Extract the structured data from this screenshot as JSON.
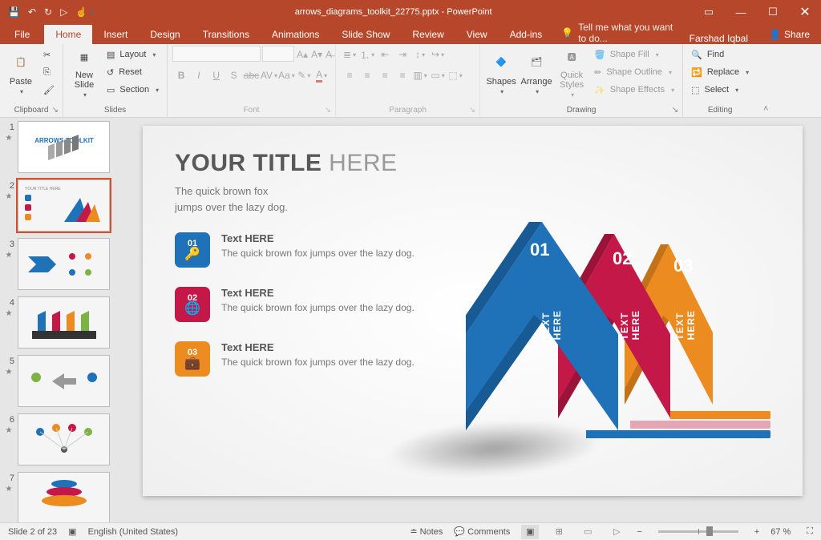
{
  "app": {
    "title": "arrows_diagrams_toolkit_22775.pptx - PowerPoint"
  },
  "qat": [
    "save",
    "undo",
    "redo",
    "start",
    "touch"
  ],
  "tabs": {
    "file": "File",
    "home": "Home",
    "insert": "Insert",
    "design": "Design",
    "transitions": "Transitions",
    "animations": "Animations",
    "slideshow": "Slide Show",
    "review": "Review",
    "view": "View",
    "addins": "Add-ins"
  },
  "tellme": "Tell me what you want to do...",
  "user": "Farshad Iqbal",
  "share": "Share",
  "ribbon": {
    "clipboard": {
      "label": "Clipboard",
      "paste": "Paste"
    },
    "slides": {
      "label": "Slides",
      "new": "New\nSlide",
      "layout": "Layout",
      "reset": "Reset",
      "section": "Section"
    },
    "font": {
      "label": "Font"
    },
    "paragraph": {
      "label": "Paragraph"
    },
    "drawing": {
      "label": "Drawing",
      "shapes": "Shapes",
      "arrange": "Arrange",
      "quick": "Quick\nStyles",
      "fill": "Shape Fill",
      "outline": "Shape Outline",
      "effects": "Shape Effects"
    },
    "editing": {
      "label": "Editing",
      "find": "Find",
      "replace": "Replace",
      "select": "Select"
    }
  },
  "thumbs": [
    {
      "n": 1,
      "label": "ARROWS TOOLKIT"
    },
    {
      "n": 2,
      "label": ""
    },
    {
      "n": 3,
      "label": ""
    },
    {
      "n": 4,
      "label": ""
    },
    {
      "n": 5,
      "label": ""
    },
    {
      "n": 6,
      "label": ""
    },
    {
      "n": 7,
      "label": ""
    }
  ],
  "slide": {
    "title_bold": "YOUR TITLE ",
    "title_light": "HERE",
    "subtitle": "The quick brown fox\njumps over the lazy dog.",
    "items": [
      {
        "num": "01",
        "heading": "Text HERE",
        "body": "The quick brown fox jumps over the lazy dog.",
        "color": "blue"
      },
      {
        "num": "02",
        "heading": "Text HERE",
        "body": "The quick brown fox jumps over the lazy dog.",
        "color": "red"
      },
      {
        "num": "03",
        "heading": "Text HERE",
        "body": "The quick brown fox jumps over the lazy dog.",
        "color": "orng"
      }
    ],
    "arrows": [
      {
        "num": "01",
        "label": "TEXT HERE",
        "color": "#1f71b8",
        "dark": "#185a93"
      },
      {
        "num": "02",
        "label": "TEXT HERE",
        "color": "#c41848",
        "dark": "#9c1339"
      },
      {
        "num": "03",
        "label": "TEXT HERE",
        "color": "#ec8b1f",
        "dark": "#c47218"
      }
    ]
  },
  "status": {
    "slide": "Slide 2 of 23",
    "lang": "English (United States)",
    "notes": "Notes",
    "comments": "Comments",
    "zoom": "67 %"
  }
}
